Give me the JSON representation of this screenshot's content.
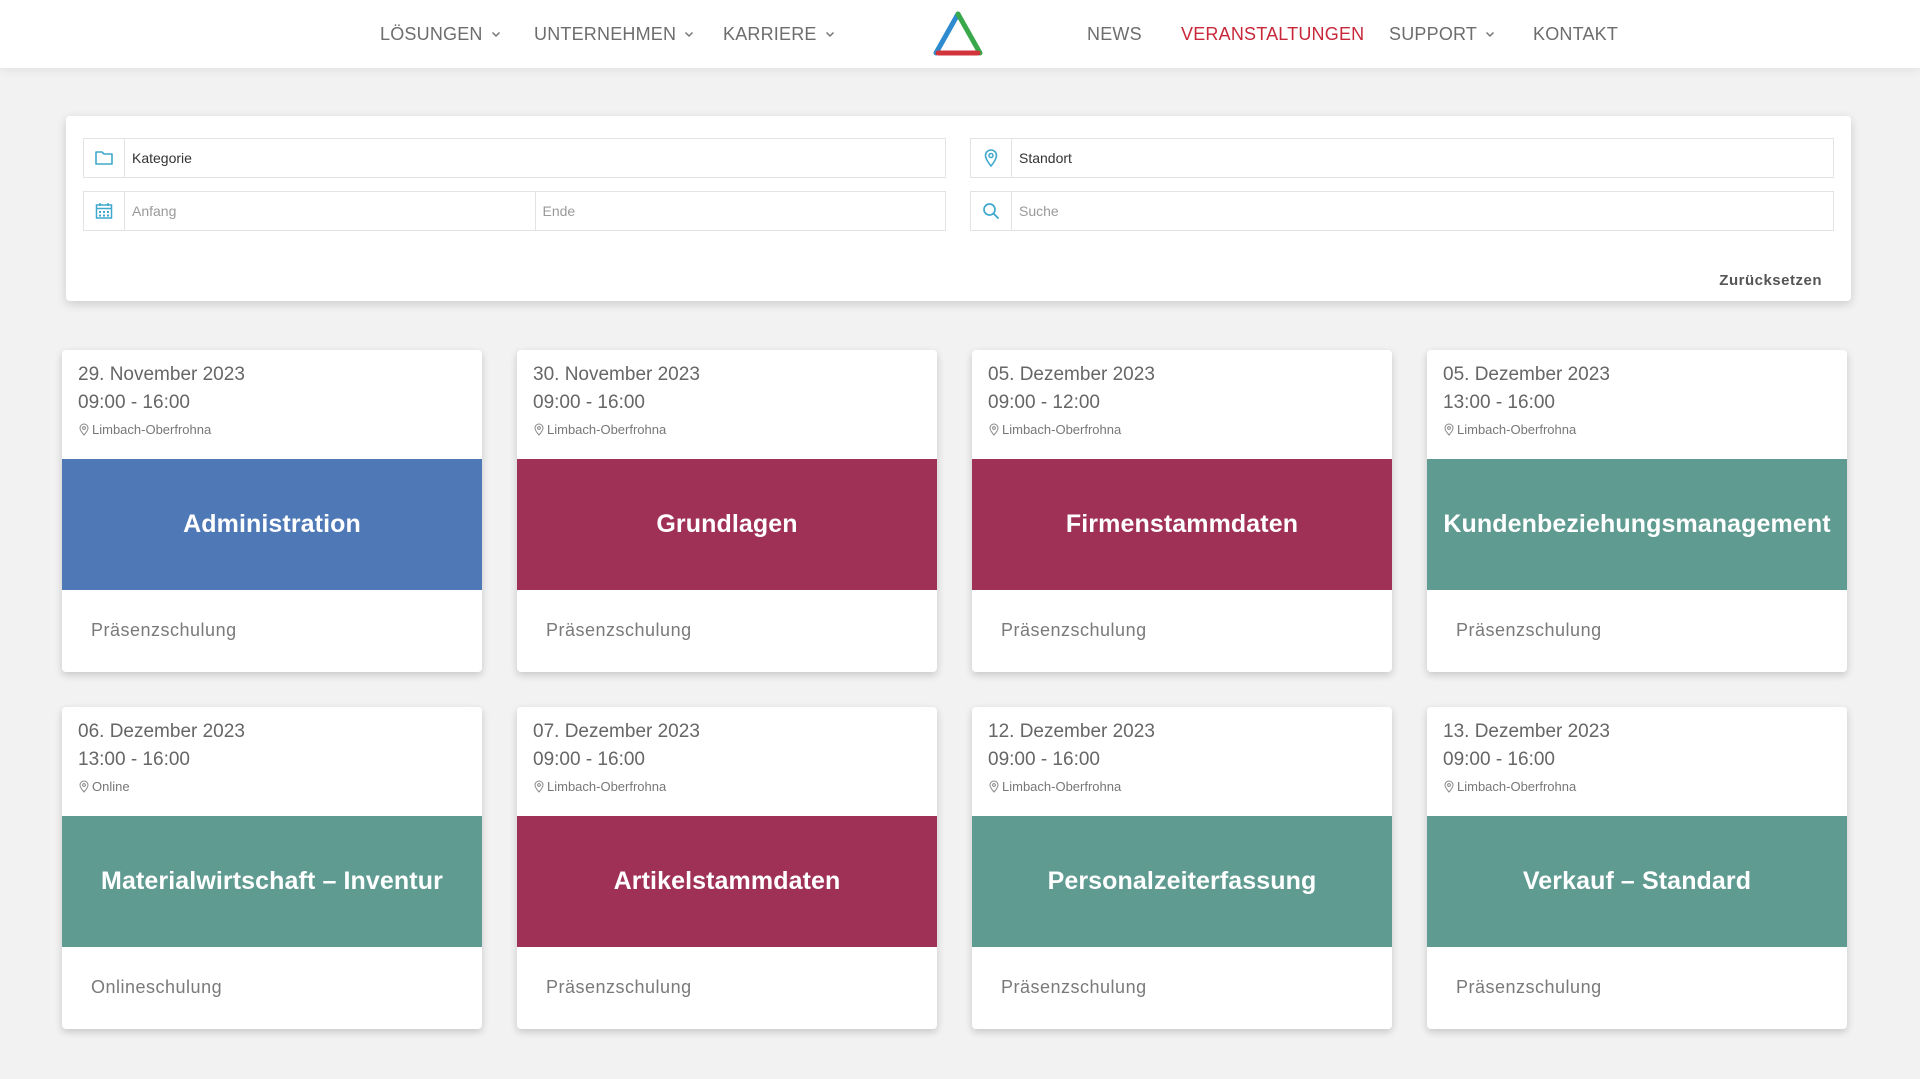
{
  "colors": {
    "active_nav": "#c8283a",
    "blue": "#4f79b6",
    "crimson": "#a03156",
    "teal": "#5f9b91",
    "icon_accent": "#3fa8cc"
  },
  "nav": {
    "left": [
      {
        "label": "LÖSUNGEN",
        "dropdown": true
      },
      {
        "label": "UNTERNEHMEN",
        "dropdown": true
      },
      {
        "label": "KARRIERE",
        "dropdown": true
      }
    ],
    "right": [
      {
        "label": "NEWS",
        "dropdown": false
      },
      {
        "label": "VERANSTALTUNGEN",
        "dropdown": false,
        "active": true
      },
      {
        "label": "SUPPORT",
        "dropdown": true
      },
      {
        "label": "KONTAKT",
        "dropdown": false
      }
    ]
  },
  "filters": {
    "category": {
      "value": "Kategorie",
      "icon": "folder-icon"
    },
    "location": {
      "value": "Standort",
      "icon": "map-pin-icon"
    },
    "start": {
      "placeholder": "Anfang",
      "icon": "calendar-icon"
    },
    "end": {
      "placeholder": "Ende"
    },
    "search": {
      "placeholder": "Suche",
      "icon": "search-icon"
    },
    "reset_label": "Zurücksetzen"
  },
  "events": [
    {
      "date": "29. November 2023",
      "time": "09:00 - 16:00",
      "location": "Limbach-Oberfrohna",
      "title": "Administration",
      "type": "Präsenzschulung",
      "color": "#4f79b6"
    },
    {
      "date": "30. November 2023",
      "time": "09:00 - 16:00",
      "location": "Limbach-Oberfrohna",
      "title": "Grundlagen",
      "type": "Präsenzschulung",
      "color": "#a03156"
    },
    {
      "date": "05. Dezember 2023",
      "time": "09:00 - 12:00",
      "location": "Limbach-Oberfrohna",
      "title": "Firmenstammdaten",
      "type": "Präsenzschulung",
      "color": "#a03156"
    },
    {
      "date": "05. Dezember 2023",
      "time": "13:00 - 16:00",
      "location": "Limbach-Oberfrohna",
      "title": "Kundenbeziehungsmanagement",
      "type": "Präsenzschulung",
      "color": "#5f9b91"
    },
    {
      "date": "06. Dezember 2023",
      "time": "13:00 - 16:00",
      "location": "Online",
      "title": "Materialwirtschaft – Inventur",
      "type": "Onlineschulung",
      "color": "#5f9b91"
    },
    {
      "date": "07. Dezember 2023",
      "time": "09:00 - 16:00",
      "location": "Limbach-Oberfrohna",
      "title": "Artikelstammdaten",
      "type": "Präsenzschulung",
      "color": "#a03156"
    },
    {
      "date": "12. Dezember 2023",
      "time": "09:00 - 16:00",
      "location": "Limbach-Oberfrohna",
      "title": "Personalzeiterfassung",
      "type": "Präsenzschulung",
      "color": "#5f9b91"
    },
    {
      "date": "13. Dezember 2023",
      "time": "09:00 - 16:00",
      "location": "Limbach-Oberfrohna",
      "title": "Verkauf – Standard",
      "type": "Präsenzschulung",
      "color": "#5f9b91"
    }
  ]
}
